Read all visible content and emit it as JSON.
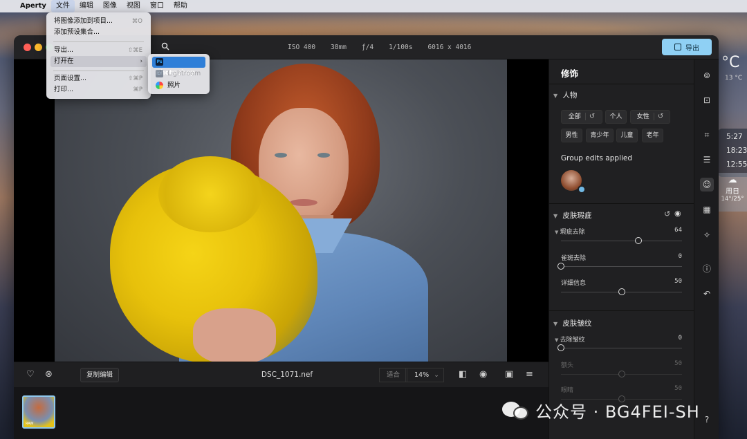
{
  "menubar": {
    "app": "Aperty",
    "items": [
      "文件",
      "编辑",
      "图像",
      "视图",
      "窗口",
      "帮助"
    ]
  },
  "file_menu": {
    "items": [
      {
        "label": "将图像添加到项目...",
        "shortcut": "⌘O"
      },
      {
        "label": "添加预设集合..."
      },
      {
        "label": "导出...",
        "shortcut": "⇧⌘E"
      },
      {
        "label": "打开在"
      },
      {
        "label": "页面设置...",
        "shortcut": "⇧⌘P"
      },
      {
        "label": "打印...",
        "shortcut": "⌘P"
      }
    ],
    "submenu_arrow": "›"
  },
  "open_in_menu": {
    "items": [
      {
        "label": "Photoshop",
        "icon": "Ps"
      },
      {
        "label": "Lightroom",
        "icon": "Lr"
      },
      {
        "label": "照片"
      }
    ]
  },
  "titlebar": {
    "iso": "ISO 400",
    "focal": "38mm",
    "aperture": "ƒ/4",
    "shutter": "1/100s",
    "resolution": "6016 x 4016",
    "export_label": "导出"
  },
  "bottom_bar": {
    "copy_edits": "复制编辑",
    "filename": "DSC_1071.nef",
    "fit_label": "适合",
    "zoom": "14%",
    "zoom_caret": "⌄"
  },
  "filmstrip": {
    "thumb_badge": "RAW"
  },
  "panel": {
    "title": "修饰",
    "people": {
      "heading": "人物",
      "chips": [
        "全部",
        "个人",
        "女性",
        "男性",
        "青少年",
        "儿童",
        "老年"
      ],
      "group_label": "Group edits applied"
    },
    "skin_blemish": {
      "heading": "皮肤瑕疵",
      "sliders": [
        {
          "label": "瑕疵去除",
          "value": 64
        },
        {
          "label": "雀斑去除",
          "value": 0
        },
        {
          "label": "详细信息",
          "value": 50
        }
      ]
    },
    "skin_wrinkles": {
      "heading": "皮肤皱纹",
      "sliders": [
        {
          "label": "去除皱纹",
          "value": 0
        },
        {
          "label": "额头",
          "value": 50
        },
        {
          "label": "眼睛",
          "value": 50
        }
      ]
    }
  },
  "desktop": {
    "temp_unit": "°C",
    "temp_small": "13 °C",
    "times": [
      "5:27",
      "18:23",
      "12:55"
    ],
    "weekday": "周日",
    "range": "14°/25°"
  },
  "watermark": {
    "text": "公众号 · BG4FEI-SH"
  },
  "colors": {
    "accent": "#8fd0f4",
    "menu_highlight": "#2f7fd8",
    "panel_bg": "#202022"
  }
}
